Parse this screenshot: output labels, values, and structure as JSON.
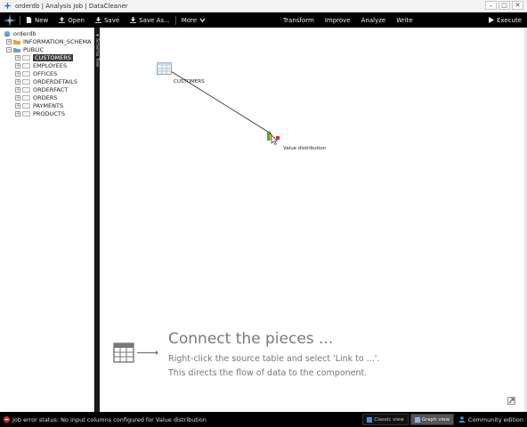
{
  "window": {
    "title": "orderdb | Analysis Job | DataCleaner",
    "controls": [
      "–",
      "□",
      "✕"
    ]
  },
  "toolbar": {
    "new_label": "New",
    "open_label": "Open",
    "save_label": "Save",
    "save_as_label": "Save As...",
    "more_label": "More",
    "nav": [
      "Transform",
      "Improve",
      "Analyze",
      "Write"
    ],
    "execute_label": "Execute"
  },
  "tree": {
    "root": "orderdb",
    "schemas": [
      "INFORMATION_SCHEMA",
      "PUBLIC"
    ],
    "tables": [
      "CUSTOMERS",
      "EMPLOYEES",
      "OFFICES",
      "ORDERDETAILS",
      "ORDERFACT",
      "ORDERS",
      "PAYMENTS",
      "PRODUCTS"
    ],
    "selected_table": "CUSTOMERS"
  },
  "strip": {
    "label": "Schema Tree"
  },
  "graph": {
    "source_node": "CUSTOMERS",
    "component_node": "Value distribution"
  },
  "hint": {
    "title": "Connect the pieces ...",
    "line1": "Right-click the source table and select 'Link to ...'.",
    "line2": "This directs the flow of data to the component."
  },
  "status": {
    "error_text": "Job error status: No input columns configured for Value distribution",
    "classic_view": "Classic view",
    "graph_view": "Graph view",
    "edition": "Community edition"
  },
  "colors": {
    "toolbar_bg": "#000000",
    "accent_blue": "#4a90d9",
    "error_red": "#d9302c",
    "selection": "#3c3c3c"
  }
}
